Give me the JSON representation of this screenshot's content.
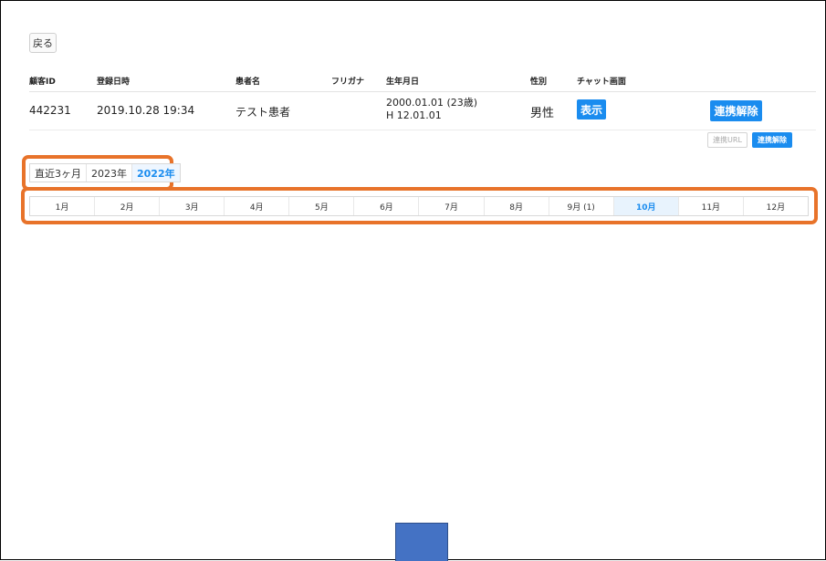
{
  "back_label": "戻る",
  "headers": {
    "customer_id": "顧客ID",
    "registered_at": "登録日時",
    "patient_name": "患者名",
    "furigana": "フリガナ",
    "birthdate": "生年月日",
    "sex": "性別",
    "chat": "チャット画面"
  },
  "patient": {
    "customer_id": "442231",
    "registered_at": "2019.10.28 19:34",
    "name": "テスト患者",
    "furigana": "",
    "birthdate_line1": "2000.01.01 (23歳)",
    "birthdate_line2": "H 12.01.01",
    "sex": "男性",
    "show_label": "表示",
    "unlink_label": "連携解除"
  },
  "secondary_actions": {
    "link_url_label": "連携URL",
    "unlink_label": "連携解除"
  },
  "year_tabs": [
    {
      "label": "直近3ヶ月",
      "active": false
    },
    {
      "label": "2023年",
      "active": false
    },
    {
      "label": "2022年",
      "active": true
    }
  ],
  "months": [
    {
      "label": "1月",
      "active": false
    },
    {
      "label": "2月",
      "active": false
    },
    {
      "label": "3月",
      "active": false
    },
    {
      "label": "4月",
      "active": false
    },
    {
      "label": "5月",
      "active": false
    },
    {
      "label": "6月",
      "active": false
    },
    {
      "label": "7月",
      "active": false
    },
    {
      "label": "8月",
      "active": false
    },
    {
      "label": "9月 (1)",
      "active": false
    },
    {
      "label": "10月",
      "active": true
    },
    {
      "label": "11月",
      "active": false
    },
    {
      "label": "12月",
      "active": false
    }
  ],
  "colors": {
    "accent": "#1a8cef",
    "highlight": "#e8732a",
    "overlay_square": "#4472c4"
  }
}
